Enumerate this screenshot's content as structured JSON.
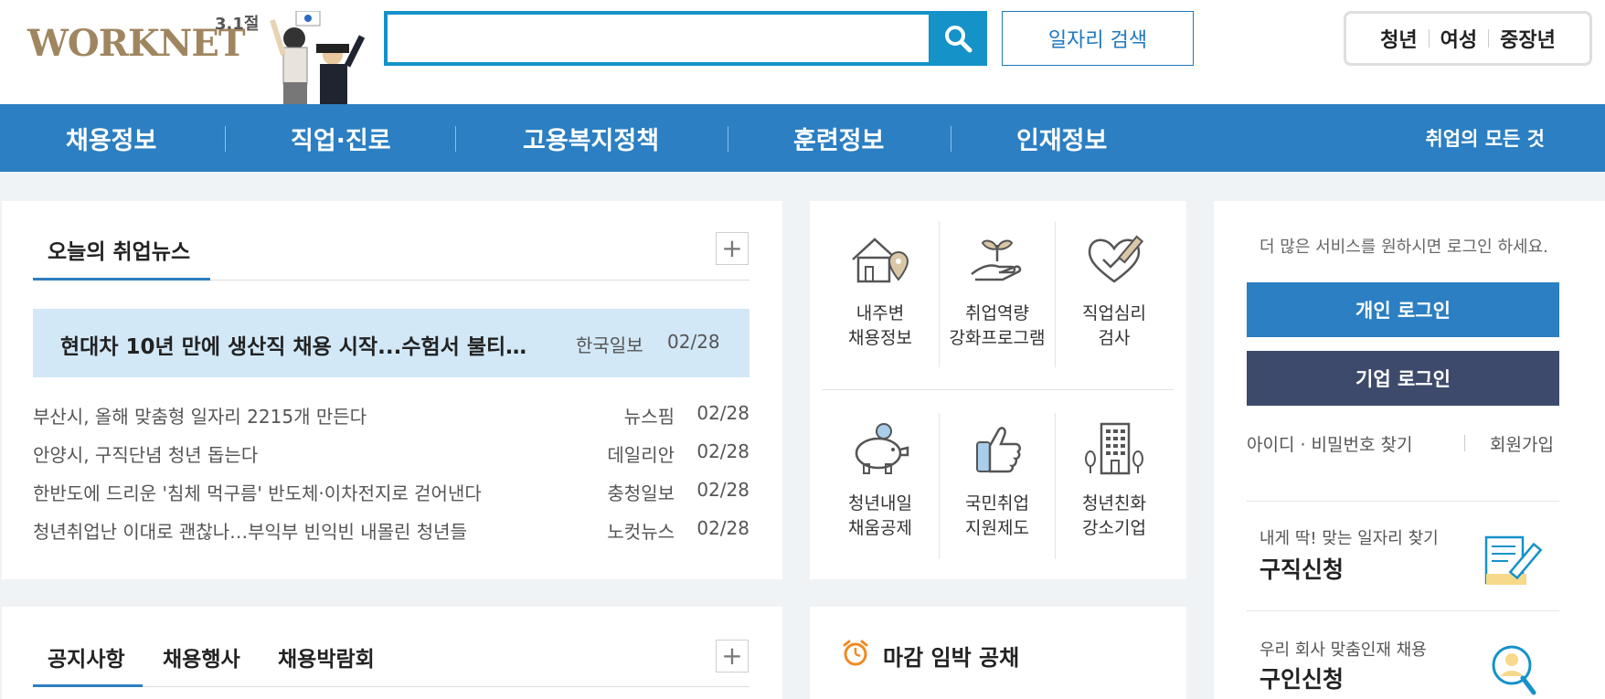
{
  "header": {
    "logo_text": "WORKNET",
    "logo_sub": "3.1절",
    "search_placeholder": "",
    "search_button_icon": "search-icon",
    "job_search_label": "일자리 검색",
    "target_groups": [
      "청년",
      "여성",
      "중장년"
    ]
  },
  "nav": {
    "items": [
      "채용정보",
      "직업·진로",
      "고용복지정책",
      "훈련정보",
      "인재정보"
    ],
    "all_label": "취업의 모든 것"
  },
  "news": {
    "title": "오늘의 취업뉴스",
    "more_label": "+",
    "featured": {
      "title": "현대차 10년 만에 생산직 채용 시작...수험서 불티…",
      "source": "한국일보",
      "date": "02/28"
    },
    "items": [
      {
        "title": "부산시, 올해 맞춤형 일자리 2215개 만든다",
        "source": "뉴스핌",
        "date": "02/28"
      },
      {
        "title": "안양시, 구직단념 청년 돕는다",
        "source": "데일리안",
        "date": "02/28"
      },
      {
        "title": "한반도에 드리운 '침체 먹구름' 반도체·이차전지로 걷어낸다",
        "source": "충청일보",
        "date": "02/28"
      },
      {
        "title": "청년취업난 이대로 괜찮나…부익부 빈익빈 내몰린 청년들",
        "source": "노컷뉴스",
        "date": "02/28"
      }
    ]
  },
  "services": [
    {
      "line1": "내주변",
      "line2": "채용정보",
      "icon": "house-location-icon"
    },
    {
      "line1": "취업역량",
      "line2": "강화프로그램",
      "icon": "sprout-hand-icon"
    },
    {
      "line1": "직업심리",
      "line2": "검사",
      "icon": "heart-pen-icon"
    },
    {
      "line1": "청년내일",
      "line2": "채움공제",
      "icon": "piggy-bank-icon"
    },
    {
      "line1": "국민취업",
      "line2": "지원제도",
      "icon": "thumbs-up-icon"
    },
    {
      "line1": "청년친화",
      "line2": "강소기업",
      "icon": "building-icon"
    }
  ],
  "login": {
    "hint": "더 많은 서비스를 원하시면 로그인 하세요.",
    "personal": "개인 로그인",
    "company": "기업 로그인",
    "find_id": "아이디 · 비밀번호 찾기",
    "join": "회원가입"
  },
  "cta": [
    {
      "sub": "내게 딱! 맞는 일자리 찾기",
      "title": "구직신청",
      "icon": "resume-pen-icon"
    },
    {
      "sub": "우리 회사 맞춤인재 채용",
      "title": "구인신청",
      "icon": "magnifier-person-icon"
    }
  ],
  "notice": {
    "tabs": [
      "공지사항",
      "채용행사",
      "채용박람회"
    ],
    "more_label": "+"
  },
  "deadline": {
    "title": "마감 임박 공채",
    "icon": "alarm-clock-icon"
  },
  "colors": {
    "brand_blue": "#2b7fc2",
    "search_blue": "#1592c8",
    "company_btn": "#3d4a6b",
    "featured_bg": "#d2e8f7",
    "page_bg": "#f0f3f6"
  }
}
